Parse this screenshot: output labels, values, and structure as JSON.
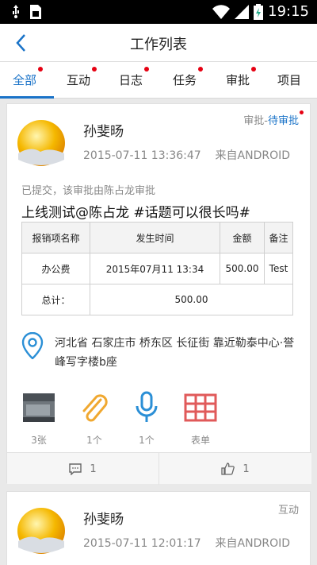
{
  "status_bar": {
    "time": "19:15",
    "icons": [
      "usb-icon",
      "sim-icon",
      "wifi-icon",
      "signal-icon",
      "battery-charging-icon"
    ]
  },
  "app_bar": {
    "title": "工作列表",
    "back_icon": "back-arrow-icon"
  },
  "tabs": [
    {
      "label": "全部",
      "active": true,
      "has_dot": true
    },
    {
      "label": "互动",
      "active": false,
      "has_dot": true
    },
    {
      "label": "日志",
      "active": false,
      "has_dot": true
    },
    {
      "label": "任务",
      "active": false,
      "has_dot": true
    },
    {
      "label": "审批",
      "active": false,
      "has_dot": true
    },
    {
      "label": "项目",
      "active": false,
      "has_dot": false
    }
  ],
  "posts": [
    {
      "author": "孙斐旸",
      "time": "2015-07-11 13:36:47",
      "source": "来自ANDROID",
      "status_prefix": "审批-",
      "status_value": "待审批",
      "note": "已提交，该审批由陈占龙审批",
      "content": "上线测试@陈占龙 #话题可以很长吗#",
      "table": {
        "headers": [
          "报销项名称",
          "发生时间",
          "金额",
          "备注"
        ],
        "rows": [
          [
            "办公费",
            "2015年07月11 13:34",
            "500.00",
            "Test"
          ]
        ],
        "total_label": "总计：",
        "total_value": "500.00"
      },
      "location": "河北省 石家庄市 桥东区 长征街 靠近勒泰中心·誉峰写字楼b座",
      "attachments": [
        {
          "icon": "photo-thumbnail-icon",
          "label": "3张"
        },
        {
          "icon": "paperclip-icon",
          "label": "1个"
        },
        {
          "icon": "microphone-icon",
          "label": "1个"
        },
        {
          "icon": "form-grid-icon",
          "label": "表单"
        }
      ],
      "comment_count": "1",
      "like_count": "1"
    },
    {
      "author": "孙斐旸",
      "time": "2015-07-11 12:01:17",
      "source": "来自ANDROID",
      "status": "互动"
    }
  ],
  "colors": {
    "accent": "#1a73c8",
    "badge": "#e60012",
    "attachment_clip": "#f0a830",
    "attachment_form": "#e05a5a"
  }
}
